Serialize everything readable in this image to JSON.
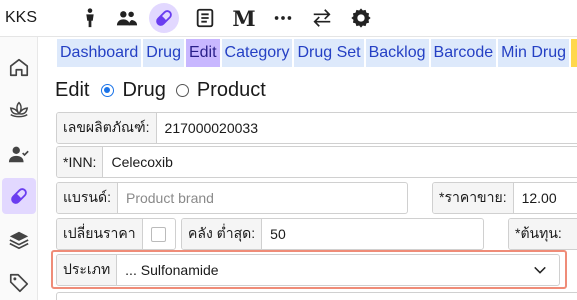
{
  "app": {
    "brand": "KKS"
  },
  "topbar": {
    "icons": [
      "person-icon",
      "group-icon",
      "pill-icon",
      "document-icon",
      "m-icon",
      "more-icon",
      "swap-icon",
      "gear-icon"
    ],
    "m_label": "M",
    "more_label": "···"
  },
  "sidebar": {
    "icons": [
      "home-icon",
      "lotus-icon",
      "user-check-icon",
      "pill-icon",
      "layers-icon",
      "tag-icon"
    ]
  },
  "tabs": [
    "Dashboard",
    "Drug",
    "Edit",
    "Category",
    "Drug Set",
    "Backlog",
    "Barcode",
    "Min Drug",
    ""
  ],
  "active_tab": "Edit",
  "editrow": {
    "label": "Edit",
    "option_drug": "Drug",
    "option_product": "Product",
    "selected": "Drug"
  },
  "form": {
    "product_code_label": "เลขผลิตภัณฑ์:",
    "product_code_value": "217000020033",
    "inn_label": "*INN:",
    "inn_value": "Celecoxib",
    "brand_label": "แบรนด์:",
    "brand_placeholder": "Product brand",
    "price_label": "*ราคาขาย:",
    "price_value": "12.00",
    "change_price_label": "เปลี่ยนราคา",
    "stock_min_label": "คลัง ต่ำสุด:",
    "stock_min_value": "50",
    "cost_label": "*ต้นทุน:",
    "type_label": "ประเภท",
    "type_value": "... Sulfonamide"
  }
}
